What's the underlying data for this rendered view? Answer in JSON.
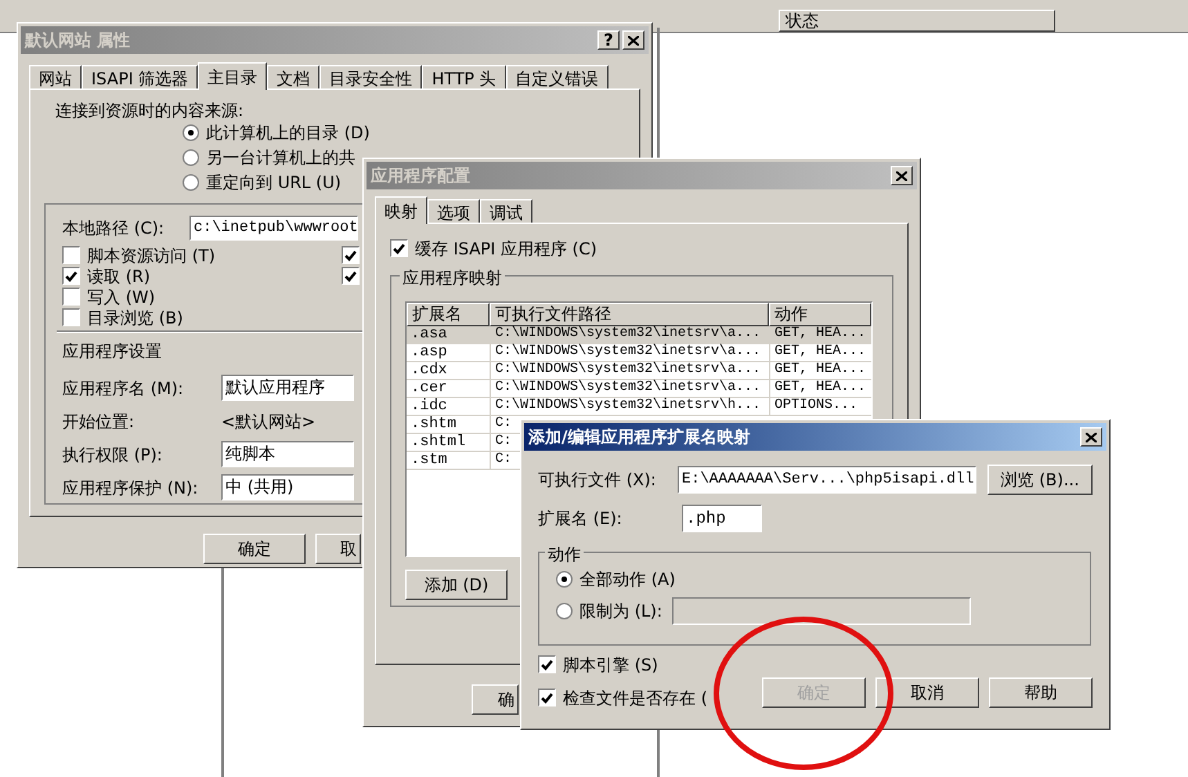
{
  "background": {
    "status_column": "状态"
  },
  "site_properties": {
    "title": "默认网站 属性",
    "active": false,
    "help_button": "?",
    "tabs": [
      {
        "label": "网站",
        "selected": false
      },
      {
        "label": "ISAPI 筛选器",
        "selected": false
      },
      {
        "label": "主目录",
        "selected": true
      },
      {
        "label": "文档",
        "selected": false
      },
      {
        "label": "目录安全性",
        "selected": false
      },
      {
        "label": "HTTP 头",
        "selected": false
      },
      {
        "label": "自定义错误",
        "selected": false
      }
    ],
    "source_label": "连接到资源时的内容来源:",
    "source_options": [
      {
        "label": "此计算机上的目录 (D)",
        "selected": true
      },
      {
        "label": "另一台计算机上的共",
        "selected": false
      },
      {
        "label": "重定向到 URL (U)",
        "selected": false
      }
    ],
    "local_path": {
      "label": "本地路径 (C):",
      "value": "c:\\inetpub\\wwwroot"
    },
    "permissions": [
      {
        "label": "脚本资源访问 (T)",
        "checked": false
      },
      {
        "label": "读取 (R)",
        "checked": true
      },
      {
        "label": "写入 (W)",
        "checked": false
      },
      {
        "label": "目录浏览 (B)",
        "checked": false
      }
    ],
    "side_checks": [
      {
        "checked": true
      },
      {
        "checked": true
      }
    ],
    "app_settings_heading": "应用程序设置",
    "app_settings": [
      {
        "label": "应用程序名 (M):",
        "value": "默认应用程序",
        "kind": "field"
      },
      {
        "label": "开始位置:",
        "value": "<默认网站>",
        "kind": "text"
      },
      {
        "label": "执行权限 (P):",
        "value": "纯脚本",
        "kind": "field"
      },
      {
        "label": "应用程序保护 (N):",
        "value": "中 (共用)",
        "kind": "field"
      }
    ],
    "buttons": [
      "确定",
      "取"
    ]
  },
  "app_config": {
    "title": "应用程序配置",
    "active": false,
    "tabs": [
      {
        "label": "映射",
        "selected": true
      },
      {
        "label": "选项",
        "selected": false
      },
      {
        "label": "调试",
        "selected": false
      }
    ],
    "cache": {
      "label": "缓存 ISAPI 应用程序 (C)",
      "checked": true
    },
    "group_label": "应用程序映射",
    "columns": [
      "扩展名",
      "可执行文件路径",
      "动作"
    ],
    "rows": [
      {
        "ext": ".asa",
        "path": "C:\\WINDOWS\\system32\\inetsrv\\a...",
        "action": "GET, HEA...",
        "selected": true
      },
      {
        "ext": ".asp",
        "path": "C:\\WINDOWS\\system32\\inetsrv\\a...",
        "action": "GET, HEA...",
        "selected": false
      },
      {
        "ext": ".cdx",
        "path": "C:\\WINDOWS\\system32\\inetsrv\\a...",
        "action": "GET, HEA...",
        "selected": false
      },
      {
        "ext": ".cer",
        "path": "C:\\WINDOWS\\system32\\inetsrv\\a...",
        "action": "GET, HEA...",
        "selected": false
      },
      {
        "ext": ".idc",
        "path": "C:\\WINDOWS\\system32\\inetsrv\\h...",
        "action": "OPTIONS...",
        "selected": false
      },
      {
        "ext": ".shtm",
        "path": "C:",
        "selected": false
      },
      {
        "ext": ".shtml",
        "path": "C:",
        "selected": false
      },
      {
        "ext": ".stm",
        "path": "C:",
        "selected": false
      }
    ],
    "add_button": "添加 (D)",
    "ok_button": "确"
  },
  "mapping_dialog": {
    "title": "添加/编辑应用程序扩展名映射",
    "active": true,
    "executable": {
      "label": "可执行文件 (X):",
      "value": "E:\\AAAAAAA\\Serv...\\php5isapi.dll"
    },
    "browse_button": "浏览 (B)...",
    "extension": {
      "label": "扩展名 (E):",
      "value": ".php"
    },
    "verbs_label": "动作",
    "verbs": [
      {
        "label": "全部动作 (A)",
        "selected": true
      },
      {
        "label": "限制为 (L):",
        "selected": false
      }
    ],
    "checks": [
      {
        "label": "脚本引擎 (S)",
        "checked": true
      },
      {
        "label": "检查文件是否存在 (",
        "checked": true
      }
    ],
    "buttons": [
      {
        "label": "确定",
        "disabled": true
      },
      {
        "label": "取消",
        "disabled": false
      },
      {
        "label": "帮助",
        "disabled": false
      }
    ]
  }
}
